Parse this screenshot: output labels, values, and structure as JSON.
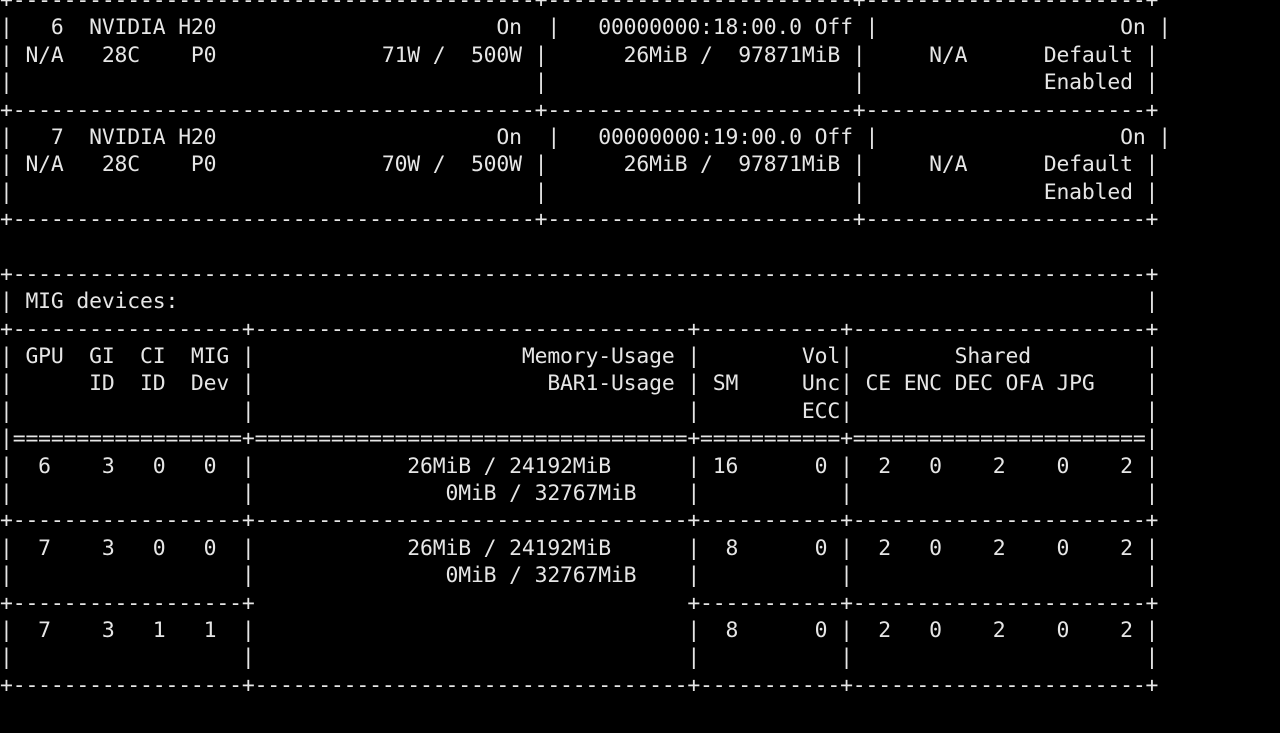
{
  "colors": {
    "background": "#000000",
    "text": "#e6e6e6"
  },
  "terminal": {
    "lines": [
      "+-----------------------------------------+------------------------+----------------------+",
      "|   6  NVIDIA H20                      On  |   00000000:18:00.0 Off |                   On |",
      "| N/A   28C    P0             71W /  500W |      26MiB /  97871MiB |     N/A      Default |",
      "|                                         |                        |              Enabled |",
      "+-----------------------------------------+------------------------+----------------------+",
      "|   7  NVIDIA H20                      On  |   00000000:19:00.0 Off |                   On |",
      "| N/A   28C    P0             70W /  500W |      26MiB /  97871MiB |     N/A      Default |",
      "|                                         |                        |              Enabled |",
      "+-----------------------------------------+------------------------+----------------------+",
      "",
      "+-----------------------------------------------------------------------------------------+",
      "| MIG devices:                                                                            |",
      "+------------------+----------------------------------+-----------+-----------------------+",
      "| GPU  GI  CI  MIG |                     Memory-Usage |        Vol|        Shared         |",
      "|      ID  ID  Dev |                       BAR1-Usage | SM     Unc| CE ENC DEC OFA JPG    |",
      "|                  |                                  |        ECC|                       |",
      "|==================+==================================+===========+=======================|",
      "|  6    3   0   0  |            26MiB / 24192MiB      | 16      0 |  2   0    2    0    2 |",
      "|                  |               0MiB / 32767MiB    |           |                       |",
      "+------------------+----------------------------------+-----------+-----------------------+",
      "|  7    3   0   0  |            26MiB / 24192MiB      |  8      0 |  2   0    2    0    2 |",
      "|                  |               0MiB / 32767MiB    |           |                       |",
      "+------------------+                                  +-----------+-----------------------+",
      "|  7    3   1   1  |                                  |  8      0 |  2   0    2    0    2 |",
      "|                  |                                  |           |                       |",
      "+------------------+----------------------------------+-----------+-----------------------+"
    ]
  }
}
